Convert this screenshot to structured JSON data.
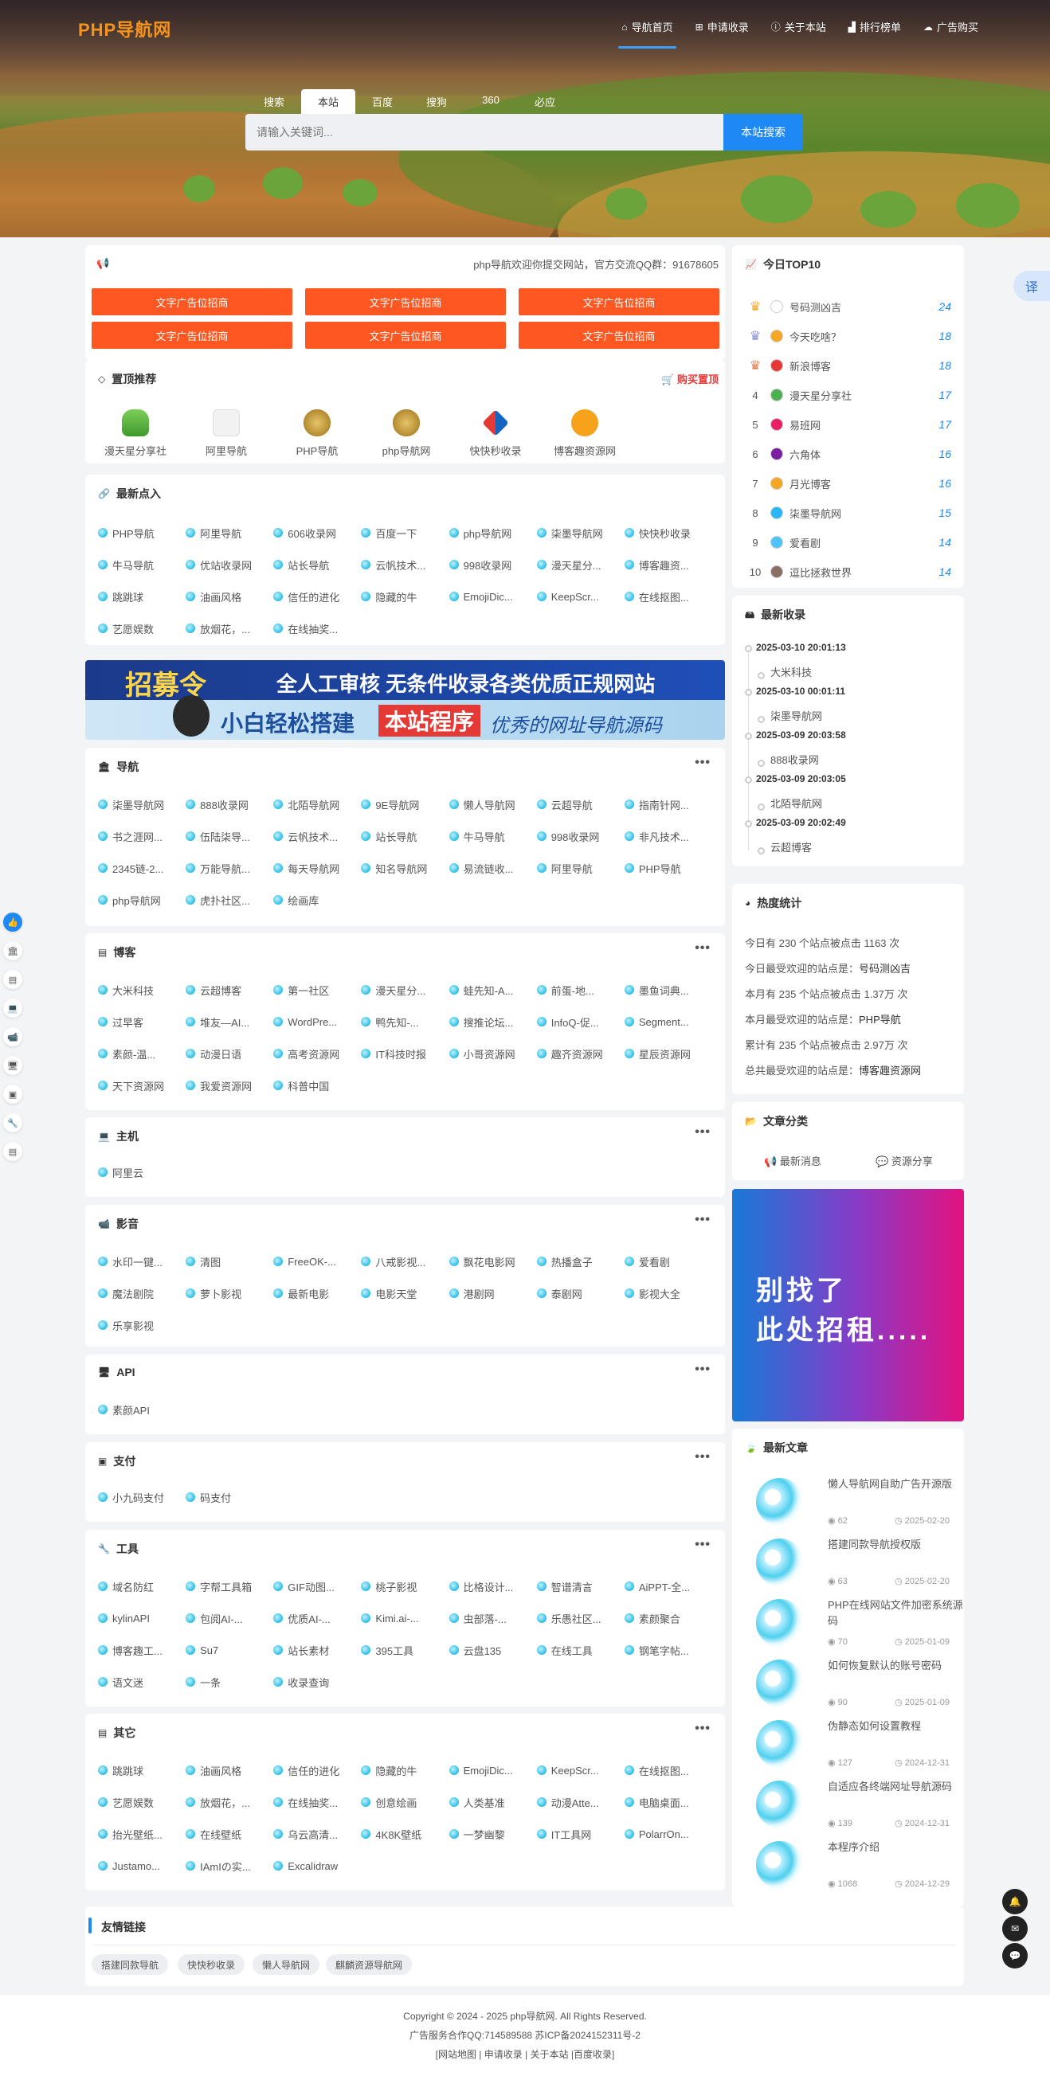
{
  "header": {
    "logo": "PHP导航网",
    "nav": [
      "导航首页",
      "申请收录",
      "关于本站",
      "排行榜单",
      "广告购买"
    ]
  },
  "search": {
    "tabs": [
      "搜索",
      "本站",
      "百度",
      "搜狗",
      "360",
      "必应"
    ],
    "placeholder": "请输入关键词...",
    "button": "本站搜索"
  },
  "notice": "php导航欢迎你提交网站，官方交流QQ群：91678605",
  "ad_buttons": [
    "文字广告位招商",
    "文字广告位招商",
    "文字广告位招商",
    "文字广告位招商",
    "文字广告位招商",
    "文字广告位招商"
  ],
  "top": {
    "title": "置顶推荐",
    "buy": "购买置顶",
    "items": [
      "漫天星分享社",
      "阿里导航",
      "PHP导航",
      "php导航网",
      "快快秒收录",
      "博客趣资源网"
    ]
  },
  "latest": {
    "title": "最新点入",
    "items": [
      "PHP导航",
      "阿里导航",
      "606收录网",
      "百度一下",
      "php导航网",
      "柒墨导航网",
      "快快秒收录",
      "牛马导航",
      "优站收录网",
      "站长导航",
      "云帆技术...",
      "998收录网",
      "漫天星分...",
      "博客趣资...",
      "跳跳球",
      "油画风格",
      "信任的进化",
      "隐藏的牛",
      "EmojiDic...",
      "KeepScr...",
      "在线抠图...",
      "艺愿娱数",
      "放烟花，...",
      "在线抽奖..."
    ]
  },
  "banner": {
    "line1a": "招募令",
    "line1b": "全人工审核  无条件收录各类优质正规网站",
    "line2a": "小白轻松搭建",
    "line2b": "本站程序",
    "line2c": "优秀的网址导航源码"
  },
  "sections": [
    {
      "name": "导航",
      "icon": "bank-icon",
      "items": [
        "柒墨导航网",
        "888收录网",
        "北陌导航网",
        "9E导航网",
        "懒人导航网",
        "云超导航",
        "指南针网...",
        "书之涯网...",
        "伍陆柒导...",
        "云帆技术...",
        "站长导航",
        "牛马导航",
        "998收录网",
        "非凡技术...",
        "2345链-2...",
        "万能导航...",
        "每天导航网",
        "知名导航网",
        "易流链收...",
        "阿里导航",
        "PHP导航",
        "php导航网",
        "虎扑社区...",
        "绘画库"
      ]
    },
    {
      "name": "博客",
      "icon": "card-icon",
      "items": [
        "大米科技",
        "云超博客",
        "第一社区",
        "漫天星分...",
        "蛙先知-A...",
        "前蛋-地...",
        "墨鱼词典...",
        "过早客",
        "堆友—AI...",
        "WordPre...",
        "鸭先知-...",
        "搜推论坛...",
        "InfoQ-促...",
        "Segment...",
        "素颜-温...",
        "动漫日语",
        "高考资源网",
        "IT科技时报",
        "小哥资源网",
        "趣齐资源网",
        "星辰资源网",
        "天下资源网",
        "我爱资源网",
        "科普中国"
      ]
    },
    {
      "name": "主机",
      "icon": "laptop-icon",
      "items": [
        "阿里云"
      ]
    },
    {
      "name": "影音",
      "icon": "video-icon",
      "items": [
        "水印一键...",
        "清图",
        "FreeOK-...",
        "八戒影视...",
        "飘花电影网",
        "热播盒子",
        "爱看剧",
        "魔法剧院",
        "萝卜影视",
        "最新电影",
        "电影天堂",
        "港剧网",
        "泰剧网",
        "影视大全",
        "乐享影视"
      ]
    },
    {
      "name": "API",
      "icon": "monitor-icon",
      "items": [
        "素颜API"
      ]
    },
    {
      "name": "支付",
      "icon": "wallet-icon",
      "items": [
        "小九码支付",
        "码支付"
      ]
    },
    {
      "name": "工具",
      "icon": "wrench-icon",
      "items": [
        "域名防红",
        "字帮工具箱",
        "GIF动图...",
        "桃子影视",
        "比格设计...",
        "智谱清言",
        "AiPPT-全...",
        "kylinAPI",
        "包阅AI-...",
        "优质AI-...",
        "Kimi.ai-...",
        "虫部落-...",
        "乐愚社区...",
        "素颜聚合",
        "博客趣工...",
        "Su7",
        "站长素材",
        "395工具",
        "云盘135",
        "在线工具",
        "钢笔字帖...",
        "语文迷",
        "一条",
        "收录查询"
      ]
    },
    {
      "name": "其它",
      "icon": "card-icon",
      "items": [
        "跳跳球",
        "油画风格",
        "信任的进化",
        "隐藏的牛",
        "EmojiDic...",
        "KeepScr...",
        "在线抠图...",
        "艺愿娱数",
        "放烟花，...",
        "在线抽奖...",
        "创意绘画",
        "人类基准",
        "动漫Atte...",
        "电脑桌面...",
        "抬光壁纸...",
        "在线壁纸",
        "乌云高清...",
        "4K8K壁纸",
        "一梦幽黎",
        "IT工具网",
        "PolarrOn...",
        "Justamo...",
        "IAmIの实...",
        "Excalidraw"
      ]
    }
  ],
  "links": {
    "title": "友情链接",
    "items": [
      "搭建同款导航",
      "快快秒收录",
      "懒人导航网",
      "麒麟资源导航网"
    ]
  },
  "top10": {
    "title": "今日TOP10",
    "items": [
      {
        "rank": "1",
        "name": "号码测凶吉",
        "views": "24"
      },
      {
        "rank": "2",
        "name": "今天吃啥？",
        "views": "18"
      },
      {
        "rank": "3",
        "name": "新浪博客",
        "views": "18"
      },
      {
        "rank": "4",
        "name": "漫天星分享社",
        "views": "17"
      },
      {
        "rank": "5",
        "name": "易班网",
        "views": "17"
      },
      {
        "rank": "6",
        "name": "六角体",
        "views": "16"
      },
      {
        "rank": "7",
        "name": "月光博客",
        "views": "16"
      },
      {
        "rank": "8",
        "name": "柒墨导航网",
        "views": "15"
      },
      {
        "rank": "9",
        "name": "爱看剧",
        "views": "14"
      },
      {
        "rank": "10",
        "name": "逗比拯救世界",
        "views": "14"
      }
    ]
  },
  "recent": {
    "title": "最新收录",
    "items": [
      {
        "date": "2025-03-10 20:01:13",
        "name": "大米科技"
      },
      {
        "date": "2025-03-10 00:01:11",
        "name": "柒墨导航网"
      },
      {
        "date": "2025-03-09 20:03:58",
        "name": "888收录网"
      },
      {
        "date": "2025-03-09 20:03:05",
        "name": "北陌导航网"
      },
      {
        "date": "2025-03-09 20:02:49",
        "name": "云超博客"
      }
    ]
  },
  "stats": {
    "title": "热度统计",
    "lines": [
      {
        "a": "今日有 230 个站点被点击 1163 次",
        "b": ""
      },
      {
        "a": "今日最受欢迎的站点是：",
        "b": "号码测凶吉"
      },
      {
        "a": "本月有 235 个站点被点击 1.37万 次",
        "b": ""
      },
      {
        "a": "本月最受欢迎的站点是：",
        "b": "PHP导航"
      },
      {
        "a": "累计有 235 个站点被点击 2.97万 次",
        "b": ""
      },
      {
        "a": "总共最受欢迎的站点是：",
        "b": "博客趣资源网"
      }
    ]
  },
  "category": {
    "title": "文章分类",
    "items": [
      "最新消息",
      "资源分享"
    ]
  },
  "rent": {
    "line1": "别找了",
    "line2": "此处招租....."
  },
  "articles": {
    "title": "最新文章",
    "items": [
      {
        "title": "懒人导航网自助广告开源版",
        "count": "62",
        "date": "2025-02-20"
      },
      {
        "title": "搭建同款导航授权版",
        "count": "63",
        "date": "2025-02-20"
      },
      {
        "title": "PHP在线网站文件加密系统源码",
        "count": "70",
        "date": "2025-01-09"
      },
      {
        "title": "如何恢复默认的账号密码",
        "count": "90",
        "date": "2025-01-09"
      },
      {
        "title": "伪静态如何设置教程",
        "count": "127",
        "date": "2024-12-31"
      },
      {
        "title": "自适应各终端网址导航源码",
        "count": "139",
        "date": "2024-12-31"
      },
      {
        "title": "本程序介绍",
        "count": "1068",
        "date": "2024-12-29"
      }
    ]
  },
  "translate": "译",
  "footer": {
    "line1": "Copyright © 2024 - 2025 php导航网. All Rights Reserved.",
    "line2": "广告服务合作QQ:714589588 苏ICP备2024152311号-2",
    "line3": "[网站地图 | 申请收录 | 关于本站 |百度收录]"
  },
  "colors": {
    "accent": "#1e88f5",
    "ad": "#ff5722",
    "logo": "#f7941d"
  }
}
